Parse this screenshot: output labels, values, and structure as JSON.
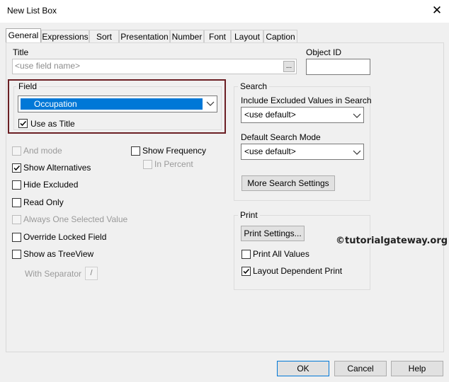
{
  "window": {
    "title": "New List Box",
    "close_glyph": "✕"
  },
  "tabs": [
    {
      "label": "General",
      "active": true
    },
    {
      "label": "Expressions"
    },
    {
      "label": "Sort"
    },
    {
      "label": "Presentation"
    },
    {
      "label": "Number"
    },
    {
      "label": "Font"
    },
    {
      "label": "Layout"
    },
    {
      "label": "Caption"
    }
  ],
  "title_section": {
    "label": "Title",
    "placeholder": "<use field name>",
    "browse_label": "..."
  },
  "object_id": {
    "label": "Object ID",
    "value": ""
  },
  "field": {
    "label": "Field",
    "selected": "Occupation",
    "use_as_title": {
      "label": "Use as Title",
      "checked": true
    }
  },
  "options": {
    "and_mode": {
      "label": "And mode",
      "checked": false,
      "disabled": true
    },
    "show_alternatives": {
      "label": "Show Alternatives",
      "checked": true
    },
    "hide_excluded": {
      "label": "Hide Excluded",
      "checked": false
    },
    "read_only": {
      "label": "Read Only",
      "checked": false
    },
    "always_one_selected": {
      "label": "Always One Selected Value",
      "checked": false,
      "disabled": true
    },
    "override_locked": {
      "label": "Override Locked Field",
      "checked": false
    },
    "show_as_treeview": {
      "label": "Show as TreeView",
      "checked": false
    },
    "with_separator": {
      "label": "With Separator",
      "value": "/"
    },
    "show_frequency": {
      "label": "Show Frequency",
      "checked": false
    },
    "in_percent": {
      "label": "In Percent",
      "checked": false,
      "disabled": true
    }
  },
  "search": {
    "label": "Search",
    "include_excluded_label": "Include Excluded Values in Search",
    "include_excluded_value": "<use default>",
    "default_mode_label": "Default Search Mode",
    "default_mode_value": "<use default>",
    "more_button": "More Search Settings"
  },
  "print": {
    "label": "Print",
    "settings_button": "Print Settings...",
    "print_all_values": {
      "label": "Print All Values",
      "checked": false
    },
    "layout_dependent": {
      "label": "Layout Dependent Print",
      "checked": true
    }
  },
  "watermark": "©tutorialgateway.org",
  "footer": {
    "ok": "OK",
    "cancel": "Cancel",
    "help": "Help"
  },
  "colors": {
    "selection": "#0078d7",
    "highlight_border": "#6b1f24"
  }
}
